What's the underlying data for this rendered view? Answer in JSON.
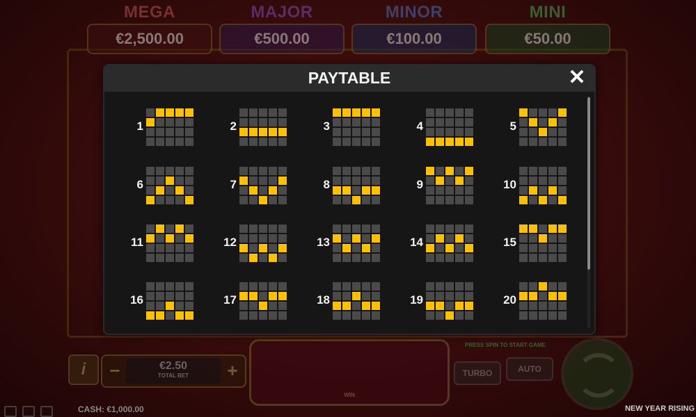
{
  "jackpots": [
    {
      "name": "MEGA",
      "value": "€2,500.00",
      "key": "mega"
    },
    {
      "name": "MAJOR",
      "value": "€500.00",
      "key": "major"
    },
    {
      "name": "MINOR",
      "value": "€100.00",
      "key": "minor"
    },
    {
      "name": "MINI",
      "value": "€50.00",
      "key": "mini"
    }
  ],
  "modal": {
    "title": "PAYTABLE",
    "close_glyph": "✕"
  },
  "paylines": [
    {
      "num": "1",
      "rows": [
        1,
        0,
        0,
        0,
        0
      ]
    },
    {
      "num": "2",
      "rows": [
        2,
        2,
        2,
        2,
        2
      ]
    },
    {
      "num": "3",
      "rows": [
        0,
        0,
        0,
        0,
        0
      ]
    },
    {
      "num": "4",
      "rows": [
        3,
        3,
        3,
        3,
        3
      ]
    },
    {
      "num": "5",
      "rows": [
        0,
        1,
        2,
        1,
        0
      ]
    },
    {
      "num": "6",
      "rows": [
        3,
        2,
        1,
        2,
        3
      ]
    },
    {
      "num": "7",
      "rows": [
        1,
        2,
        3,
        2,
        1
      ]
    },
    {
      "num": "8",
      "rows": [
        2,
        2,
        3,
        2,
        2
      ]
    },
    {
      "num": "9",
      "rows": [
        0,
        1,
        0,
        1,
        0
      ]
    },
    {
      "num": "10",
      "rows": [
        3,
        2,
        3,
        2,
        3
      ]
    },
    {
      "num": "11",
      "rows": [
        1,
        0,
        1,
        0,
        1
      ]
    },
    {
      "num": "12",
      "rows": [
        2,
        3,
        2,
        3,
        2
      ]
    },
    {
      "num": "13",
      "rows": [
        1,
        2,
        1,
        2,
        1
      ]
    },
    {
      "num": "14",
      "rows": [
        2,
        1,
        2,
        1,
        2
      ]
    },
    {
      "num": "15",
      "rows": [
        0,
        0,
        1,
        0,
        0
      ]
    },
    {
      "num": "16",
      "rows": [
        3,
        3,
        2,
        3,
        3
      ]
    },
    {
      "num": "17",
      "rows": [
        1,
        1,
        2,
        1,
        1
      ]
    },
    {
      "num": "18",
      "rows": [
        2,
        2,
        1,
        2,
        2
      ]
    },
    {
      "num": "19",
      "rows": [
        2,
        2,
        3,
        2,
        2
      ]
    },
    {
      "num": "20",
      "rows": [
        1,
        1,
        0,
        1,
        1
      ]
    }
  ],
  "bottom": {
    "info_label": "i",
    "bet_minus": "−",
    "bet_plus": "+",
    "bet_amount": "€2.50",
    "bet_label": "TOTAL BET",
    "win_label": "WIN",
    "press_spin": "PRESS SPIN TO START GAME",
    "turbo_label": "TURBO",
    "auto_label": "AUTO"
  },
  "footer": {
    "cash": "CASH: €1,000.00",
    "game_name": "NEW YEAR RISING"
  },
  "colors": {
    "active_cell": "#ffc000",
    "inactive_cell": "#4a4a4a",
    "modal_bg": "#161616"
  }
}
